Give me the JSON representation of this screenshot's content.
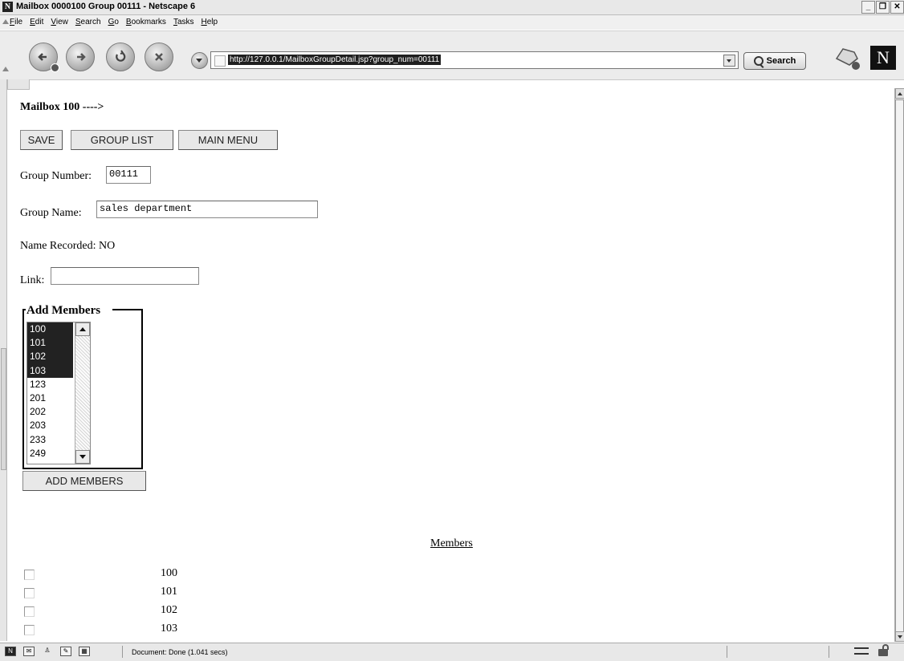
{
  "window": {
    "title": "Mailbox 0000100 Group 00111 - Netscape 6",
    "logo_letter": "N",
    "minimize": "_",
    "restore": "❐",
    "close": "✕"
  },
  "menu": {
    "items": [
      "File",
      "Edit",
      "View",
      "Search",
      "Go",
      "Bookmarks",
      "Tasks",
      "Help"
    ]
  },
  "toolbar": {
    "url": "http://127.0.0.1/MailboxGroupDetail.jsp?group_num=00111",
    "search_label": "Search",
    "brand_letter": "N"
  },
  "page": {
    "heading": "Mailbox 100 ---->",
    "buttons": {
      "save": "SAVE",
      "group_list": "GROUP LIST",
      "main_menu": "MAIN MENU",
      "add_members": "ADD MEMBERS"
    },
    "group_number_label": "Group Number:",
    "group_number_value": "00111",
    "group_name_label": "Group Name:",
    "group_name_value": "sales department",
    "name_recorded": "Name Recorded: NO",
    "link_label": "Link:",
    "link_value": "",
    "add_members_legend": "Add Members",
    "add_members_options": [
      {
        "value": "100",
        "selected": true
      },
      {
        "value": "101",
        "selected": true
      },
      {
        "value": "102",
        "selected": true
      },
      {
        "value": "103",
        "selected": true
      },
      {
        "value": "123",
        "selected": false
      },
      {
        "value": "201",
        "selected": false
      },
      {
        "value": "202",
        "selected": false
      },
      {
        "value": "203",
        "selected": false
      },
      {
        "value": "233",
        "selected": false
      },
      {
        "value": "249",
        "selected": false
      }
    ],
    "members_title": "Members",
    "members": [
      {
        "number": "100",
        "checked": false
      },
      {
        "number": "101",
        "checked": false
      },
      {
        "number": "102",
        "checked": false
      },
      {
        "number": "103",
        "checked": false
      }
    ]
  },
  "status": {
    "text": "Document: Done (1.041 secs)"
  }
}
